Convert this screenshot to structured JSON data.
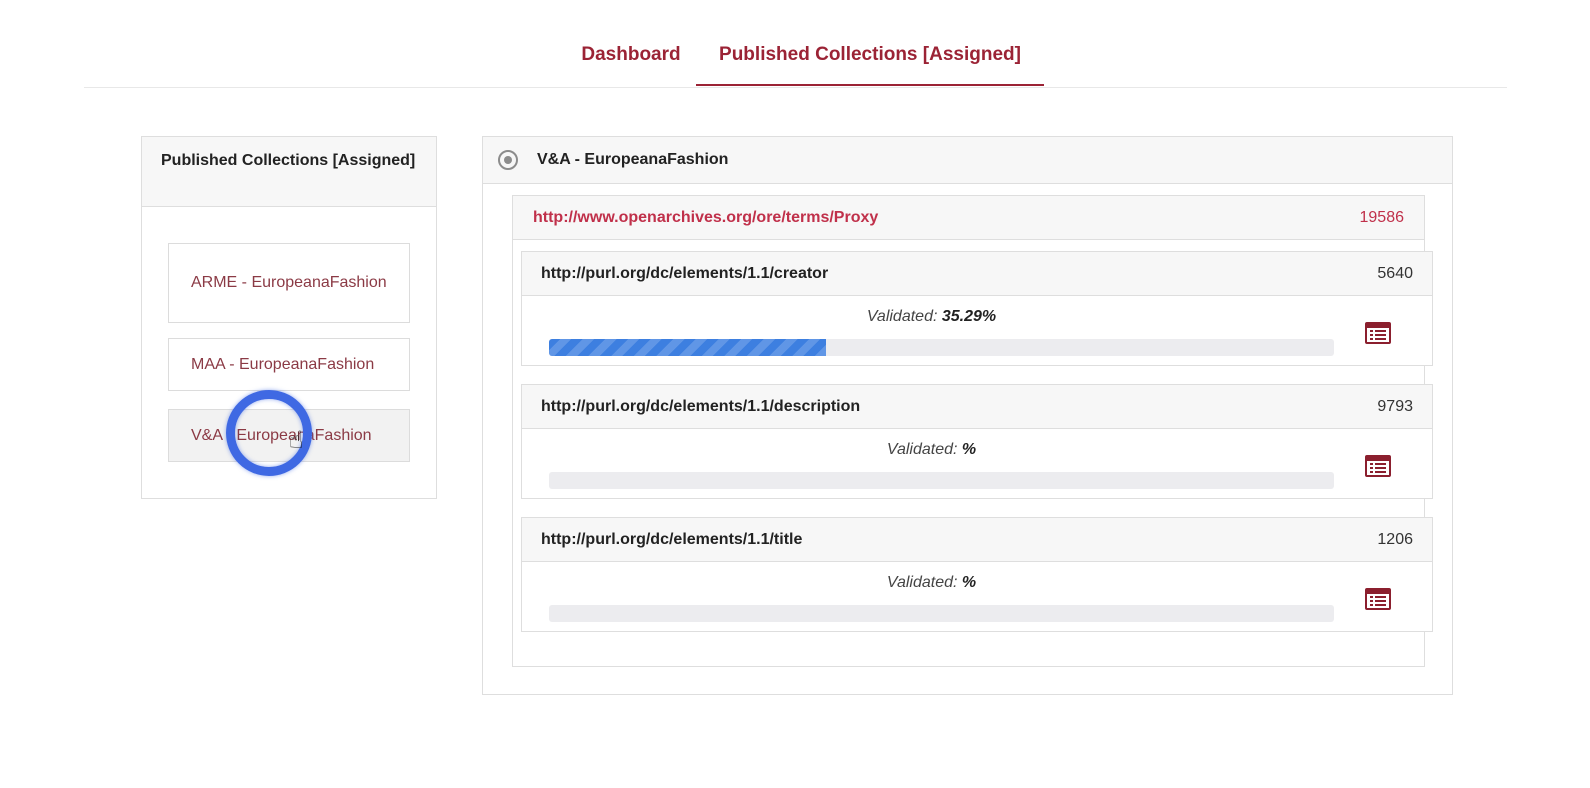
{
  "tabs": [
    {
      "label": "Dashboard"
    },
    {
      "label": "Published Collections [Assigned]"
    }
  ],
  "left_panel": {
    "title": "Published Collections [Assigned]",
    "collections": [
      {
        "label": "ARME - EuropeanaFashion"
      },
      {
        "label": "MAA - EuropeanaFashion"
      },
      {
        "label": "V&A - EuropeanaFashion"
      }
    ]
  },
  "right_panel": {
    "title": "V&A - EuropeanaFashion",
    "proxy": {
      "label": "http://www.openarchives.org/ore/terms/Proxy",
      "count": "19586"
    },
    "validated_label": "Validated:",
    "properties": [
      {
        "name": "http://purl.org/dc/elements/1.1/creator",
        "count": "5640",
        "validated_value": "35.29%",
        "progress_percent": 35.29
      },
      {
        "name": "http://purl.org/dc/elements/1.1/description",
        "count": "9793",
        "validated_value": "%",
        "progress_percent": 0
      },
      {
        "name": "http://purl.org/dc/elements/1.1/title",
        "count": "1206",
        "validated_value": "%",
        "progress_percent": 0
      }
    ]
  },
  "colors": {
    "accent": "#9b2335",
    "link": "#c0304a",
    "progress": "#3d7fe0",
    "click_ring": "#3f69e3"
  }
}
